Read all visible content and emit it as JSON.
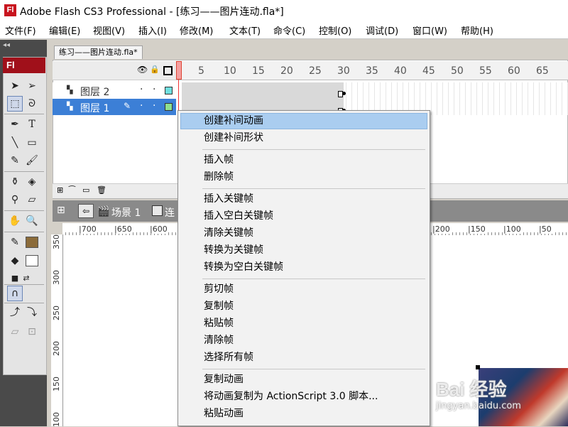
{
  "window": {
    "app_icon": "Fl",
    "title": "Adobe Flash CS3 Professional - [练习——图片连动.fla*]"
  },
  "menubar": [
    "文件(F)",
    "编辑(E)",
    "视图(V)",
    "插入(I)",
    "修改(M)",
    "文本(T)",
    "命令(C)",
    "控制(O)",
    "调试(D)",
    "窗口(W)",
    "帮助(H)"
  ],
  "toolbar": {
    "badge": "Fl",
    "collapse": "◂◂"
  },
  "document_tab": "练习——图片连动.fla*",
  "timeline": {
    "ruler": [
      "5",
      "10",
      "15",
      "20",
      "25",
      "30",
      "35",
      "40",
      "45",
      "50",
      "55",
      "60",
      "65"
    ],
    "layers": [
      {
        "name": "图层 2",
        "selected": false
      },
      {
        "name": "图层 1",
        "selected": true
      }
    ]
  },
  "editbar": {
    "scene": "场景 1",
    "object": "连"
  },
  "h_ruler_left": [
    "700",
    "650",
    "600"
  ],
  "h_ruler_right": [
    "200",
    "150",
    "100",
    "50"
  ],
  "v_ruler": [
    "350",
    "300",
    "250",
    "200",
    "150",
    "100"
  ],
  "context_menu": {
    "groups": [
      [
        "创建补间动画",
        "创建补间形状"
      ],
      [
        "插入帧",
        "删除帧"
      ],
      [
        "插入关键帧",
        "插入空白关键帧",
        "清除关键帧",
        "转换为关键帧",
        "转换为空白关键帧"
      ],
      [
        "剪切帧",
        "复制帧",
        "粘贴帧",
        "清除帧",
        "选择所有帧"
      ],
      [
        "复制动画",
        "将动画复制为 ActionScript 3.0 脚本...",
        "粘贴动画"
      ]
    ],
    "hovered": "创建补间动画"
  },
  "watermark": {
    "main": "Bai 经验",
    "sub": "jingyan.baidu.com"
  },
  "colors": {
    "fl_red": "#c8141e",
    "menu_hover": "#aacdf0",
    "layer_selected": "#3c7fd6"
  }
}
